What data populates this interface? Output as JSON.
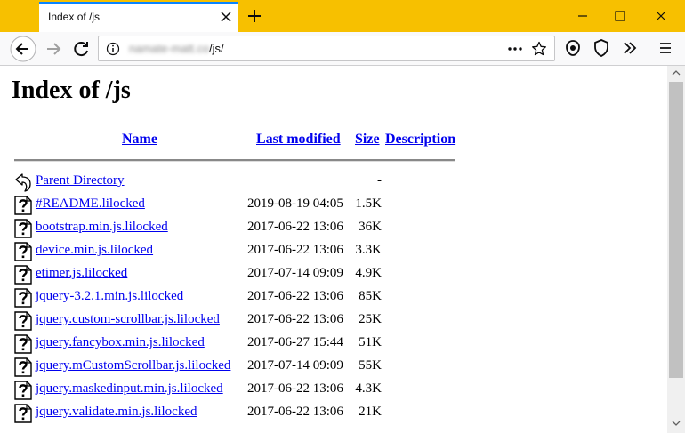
{
  "browser": {
    "tab_title": "Index of /js",
    "url_host": "namate-matt.co",
    "url_path": "/js/"
  },
  "page": {
    "title": "Index of /js",
    "columns": {
      "name": "Name",
      "last_modified": "Last modified",
      "size": "Size",
      "description": "Description"
    },
    "rows": [
      {
        "name": "Parent Directory",
        "date": "",
        "size": "-",
        "icon": "back-arrow-icon"
      },
      {
        "name": "#README.lilocked",
        "date": "2019-08-19 04:05",
        "size": "1.5K",
        "icon": "unknown-file-icon"
      },
      {
        "name": "bootstrap.min.js.lilocked",
        "date": "2017-06-22 13:06",
        "size": "36K",
        "icon": "unknown-file-icon"
      },
      {
        "name": "device.min.js.lilocked",
        "date": "2017-06-22 13:06",
        "size": "3.3K",
        "icon": "unknown-file-icon"
      },
      {
        "name": "etimer.js.lilocked",
        "date": "2017-07-14 09:09",
        "size": "4.9K",
        "icon": "unknown-file-icon"
      },
      {
        "name": "jquery-3.2.1.min.js.lilocked",
        "date": "2017-06-22 13:06",
        "size": "85K",
        "icon": "unknown-file-icon"
      },
      {
        "name": "jquery.custom-scrollbar.js.lilocked",
        "date": "2017-06-22 13:06",
        "size": "25K",
        "icon": "unknown-file-icon"
      },
      {
        "name": "jquery.fancybox.min.js.lilocked",
        "date": "2017-06-27 15:44",
        "size": "51K",
        "icon": "unknown-file-icon"
      },
      {
        "name": "jquery.mCustomScrollbar.js.lilocked",
        "date": "2017-07-14 09:09",
        "size": "55K",
        "icon": "unknown-file-icon"
      },
      {
        "name": "jquery.maskedinput.min.js.lilocked",
        "date": "2017-06-22 13:06",
        "size": "4.3K",
        "icon": "unknown-file-icon"
      },
      {
        "name": "jquery.validate.min.js.lilocked",
        "date": "2017-06-22 13:06",
        "size": "21K",
        "icon": "unknown-file-icon"
      }
    ]
  },
  "colors": {
    "titlebar": "#f7c000",
    "link": "#0000ee",
    "tab_accent": "#0a84ff"
  }
}
